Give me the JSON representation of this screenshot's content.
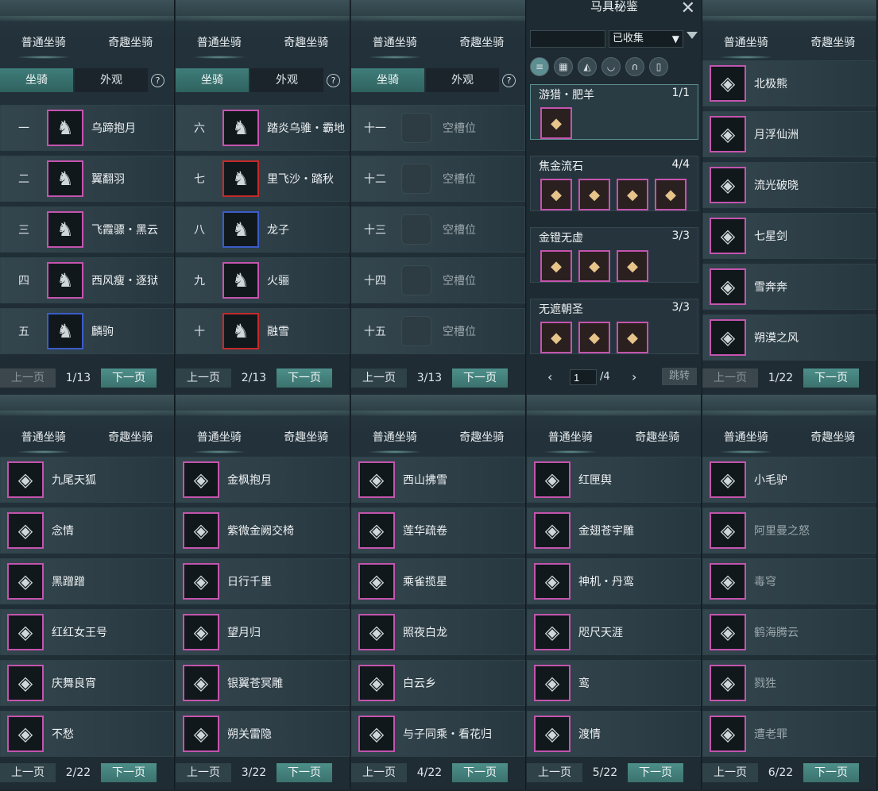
{
  "tabs": {
    "normal": "普通坐骑",
    "fun": "奇趣坐骑"
  },
  "sub": {
    "mount": "坐骑",
    "look": "外观",
    "help": "?"
  },
  "pager": {
    "prev": "上一页",
    "next": "下一页"
  },
  "top_panels": [
    {
      "page": "1/13",
      "slots": [
        [
          "一",
          "乌蹄抱月"
        ],
        [
          "二",
          "翼翻羽"
        ],
        [
          "三",
          "飞霞骠・黑云"
        ],
        [
          "四",
          "西风瘦・逐狱"
        ],
        [
          "五",
          "麟驹"
        ]
      ]
    },
    {
      "page": "2/13",
      "slots": [
        [
          "六",
          "踏炎乌骓・霸地"
        ],
        [
          "七",
          "里飞沙・踏秋"
        ],
        [
          "八",
          "龙子"
        ],
        [
          "九",
          "火骊"
        ],
        [
          "十",
          "融雪"
        ]
      ]
    },
    {
      "page": "3/13",
      "slots": [
        [
          "十一",
          "空槽位"
        ],
        [
          "十二",
          "空槽位"
        ],
        [
          "十三",
          "空槽位"
        ],
        [
          "十四",
          "空槽位"
        ],
        [
          "十五",
          "空槽位"
        ]
      ]
    }
  ],
  "right_top": {
    "page": "1/22",
    "items": [
      "北极熊",
      "月浮仙洲",
      "流光破晓",
      "七星剑",
      "雪奔奔",
      "朔漠之风"
    ]
  },
  "codex": {
    "title": "马具秘鉴",
    "close": "✕",
    "filter": "已收集",
    "page": "1",
    "total": "/4",
    "jump": "跳转",
    "groups": [
      {
        "name": "游猎・肥羊",
        "count": "1/1",
        "n": 1
      },
      {
        "name": "焦金流石",
        "count": "4/4",
        "n": 4
      },
      {
        "name": "金镫无虚",
        "count": "3/3",
        "n": 3
      },
      {
        "name": "无遮朝圣",
        "count": "3/3",
        "n": 3
      }
    ]
  },
  "bottom_panels": [
    {
      "page": "2/22",
      "items": [
        "九尾天狐",
        "念情",
        "黑蹭蹭",
        "红红女王号",
        "庆舞良宵",
        "不愁"
      ]
    },
    {
      "page": "3/22",
      "items": [
        "金枫抱月",
        "紫微金阙交椅",
        "日行千里",
        "望月归",
        "银翼苍冥雕",
        "朔关雷隐"
      ]
    },
    {
      "page": "4/22",
      "items": [
        "西山拂雪",
        "莲华疏卷",
        "乘雀揽星",
        "照夜白龙",
        "白云乡",
        "与子同乘・看花归"
      ]
    },
    {
      "page": "5/22",
      "items": [
        "红匣舆",
        "金翅苍宇雕",
        "神机・丹鸾",
        "咫尺天涯",
        "鸾",
        "渡情"
      ]
    },
    {
      "page": "6/22",
      "items": [
        "小毛驴",
        "阿里曼之怒",
        "毒穹",
        "鹤海腾云",
        "戮狌",
        "遭老罪"
      ]
    }
  ]
}
